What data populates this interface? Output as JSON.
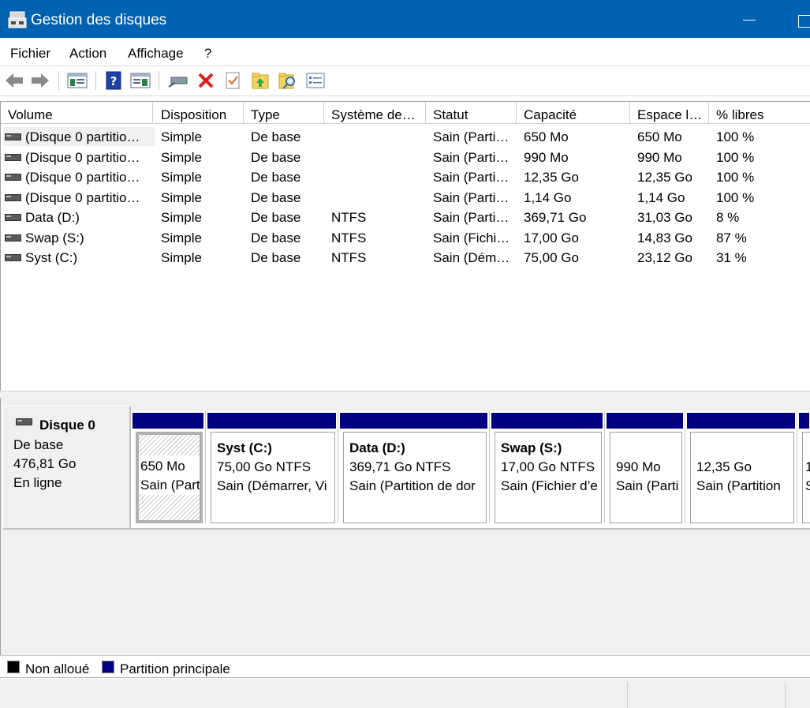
{
  "window": {
    "title": "Gestion des disques",
    "accent_color": "#0063b1"
  },
  "menu": {
    "items": [
      "Fichier",
      "Action",
      "Affichage",
      "?"
    ]
  },
  "toolbar": {
    "icons": [
      "back-arrow-icon",
      "forward-arrow-icon",
      "console-tree-icon",
      "help-icon",
      "action-pane-icon",
      "connect-drive-icon",
      "delete-icon",
      "properties-check-icon",
      "folder-up-icon",
      "folder-search-icon",
      "list-settings-icon"
    ]
  },
  "volume_list": {
    "columns": [
      "Volume",
      "Disposition",
      "Type",
      "Système de…",
      "Statut",
      "Capacité",
      "Espace l…",
      "% libres"
    ],
    "rows": [
      {
        "volume": "(Disque 0 partitio…",
        "disposition": "Simple",
        "type": "De base",
        "fs": "",
        "statut": "Sain (Parti…",
        "capacite": "650 Mo",
        "espace": "650 Mo",
        "libres": "100 %"
      },
      {
        "volume": "(Disque 0 partitio…",
        "disposition": "Simple",
        "type": "De base",
        "fs": "",
        "statut": "Sain (Parti…",
        "capacite": "990 Mo",
        "espace": "990 Mo",
        "libres": "100 %"
      },
      {
        "volume": "(Disque 0 partitio…",
        "disposition": "Simple",
        "type": "De base",
        "fs": "",
        "statut": "Sain (Parti…",
        "capacite": "12,35 Go",
        "espace": "12,35 Go",
        "libres": "100 %"
      },
      {
        "volume": "(Disque 0 partitio…",
        "disposition": "Simple",
        "type": "De base",
        "fs": "",
        "statut": "Sain (Parti…",
        "capacite": "1,14 Go",
        "espace": "1,14 Go",
        "libres": "100 %"
      },
      {
        "volume": "Data (D:)",
        "disposition": "Simple",
        "type": "De base",
        "fs": "NTFS",
        "statut": "Sain (Parti…",
        "capacite": "369,71 Go",
        "espace": "31,03 Go",
        "libres": "8 %"
      },
      {
        "volume": "Swap (S:)",
        "disposition": "Simple",
        "type": "De base",
        "fs": "NTFS",
        "statut": "Sain (Fichi…",
        "capacite": "17,00 Go",
        "espace": "14,83 Go",
        "libres": "87 %"
      },
      {
        "volume": "Syst (C:)",
        "disposition": "Simple",
        "type": "De base",
        "fs": "NTFS",
        "statut": "Sain (Dém…",
        "capacite": "75,00 Go",
        "espace": "23,12 Go",
        "libres": "31 %"
      }
    ]
  },
  "disk": {
    "name": "Disque 0",
    "type": "De base",
    "size": "476,81 Go",
    "state": "En ligne"
  },
  "partitions": [
    {
      "name": "",
      "size": "650 Mo",
      "status": "Sain (Part"
    },
    {
      "name": "Syst  (C:)",
      "size": "75,00 Go NTFS",
      "status": "Sain (Démarrer, Vi"
    },
    {
      "name": "Data  (D:)",
      "size": "369,71 Go NTFS",
      "status": "Sain (Partition de dor"
    },
    {
      "name": "Swap  (S:)",
      "size": "17,00 Go NTFS",
      "status": "Sain (Fichier d’e"
    },
    {
      "name": "",
      "size": "990 Mo",
      "status": "Sain (Parti"
    },
    {
      "name": "",
      "size": "12,35 Go",
      "status": "Sain (Partition"
    },
    {
      "name": "",
      "size": "1",
      "status": "S"
    }
  ],
  "legend": {
    "unallocated": {
      "label": "Non alloué",
      "color": "#000000"
    },
    "primary": {
      "label": "Partition principale",
      "color": "#000080"
    }
  }
}
